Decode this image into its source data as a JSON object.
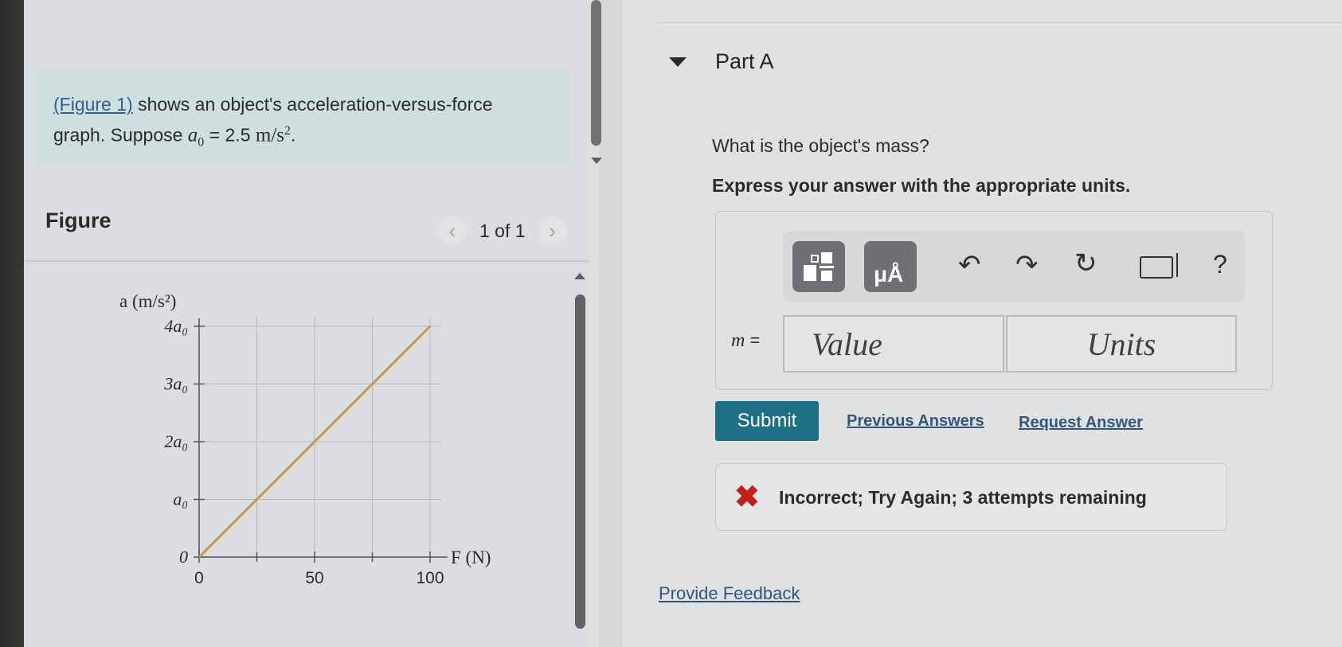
{
  "intro": {
    "figure_link": "(Figure 1)",
    "text_1": " shows an object's acceleration-versus-force",
    "text_2": "graph. Suppose ",
    "a0_symbol": "a",
    "a0_sub": "0",
    "a0_value": " = 2.5 ",
    "a0_units": "m/s",
    "a0_units_exp": "2",
    "end": "."
  },
  "figure": {
    "title": "Figure",
    "pager_text": "1 of 1",
    "prev_icon": "chevron-left-icon",
    "next_icon": "chevron-right-icon"
  },
  "chart_data": {
    "type": "line",
    "ylabel": "a (m/s²)",
    "xlabel": "F (N)",
    "x_tick_labels": [
      "0",
      "50",
      "100"
    ],
    "y_tick_labels": [
      "0",
      "a₀",
      "2a₀",
      "3a₀",
      "4a₀"
    ],
    "xlim": [
      0,
      100
    ],
    "ylim": [
      0,
      4
    ],
    "grid": true,
    "series": [
      {
        "name": "",
        "color": "#c99456",
        "x": [
          0,
          100
        ],
        "y": [
          0,
          4
        ]
      }
    ]
  },
  "part": {
    "title": "Part A",
    "question": "What is the object's mass?",
    "instruction": "Express your answer with the appropriate units.",
    "label_symbol": "m",
    "label_eq": " =",
    "value_placeholder": "Value",
    "units_placeholder": "Units",
    "toolbar_icons": [
      "templates-icon",
      "units-icon",
      "undo-icon",
      "redo-icon",
      "reset-icon",
      "keyboard-icon",
      "help-icon"
    ],
    "help_label": "?",
    "units_tile_label": "μÅ"
  },
  "actions": {
    "submit": "Submit",
    "previous_answers": "Previous Answers",
    "request_answer": "Request Answer"
  },
  "feedback": {
    "icon": "x-icon",
    "message": "Incorrect; Try Again; 3 attempts remaining",
    "color": "#c0201c"
  },
  "footer": {
    "provide_feedback": "Provide Feedback"
  }
}
